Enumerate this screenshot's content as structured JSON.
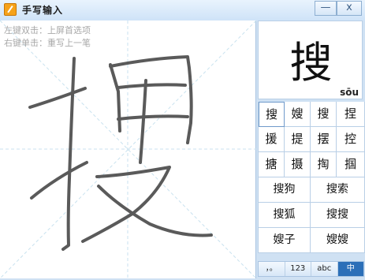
{
  "window": {
    "title": "手写输入",
    "min_label": "—",
    "close_label": "x"
  },
  "canvas": {
    "hint_left_double": "左键双击：上屏首选项",
    "hint_right_single": "右键单击：重写上一笔"
  },
  "preview": {
    "char": "搜",
    "pinyin": "sōu"
  },
  "candidates_single": [
    [
      "搜",
      "嫂",
      "搜",
      "捏"
    ],
    [
      "援",
      "提",
      "摆",
      "控"
    ],
    [
      "搪",
      "摄",
      "掏",
      "掴"
    ]
  ],
  "candidates_double": [
    [
      "搜狗",
      "搜索"
    ],
    [
      "搜狐",
      "搜搜"
    ],
    [
      "嫂子",
      "嫂嫂"
    ]
  ],
  "toolbar": [
    {
      "label": "，。",
      "active": false
    },
    {
      "label": "123",
      "active": false
    },
    {
      "label": "abc",
      "active": false
    },
    {
      "label": "中",
      "active": true
    }
  ]
}
